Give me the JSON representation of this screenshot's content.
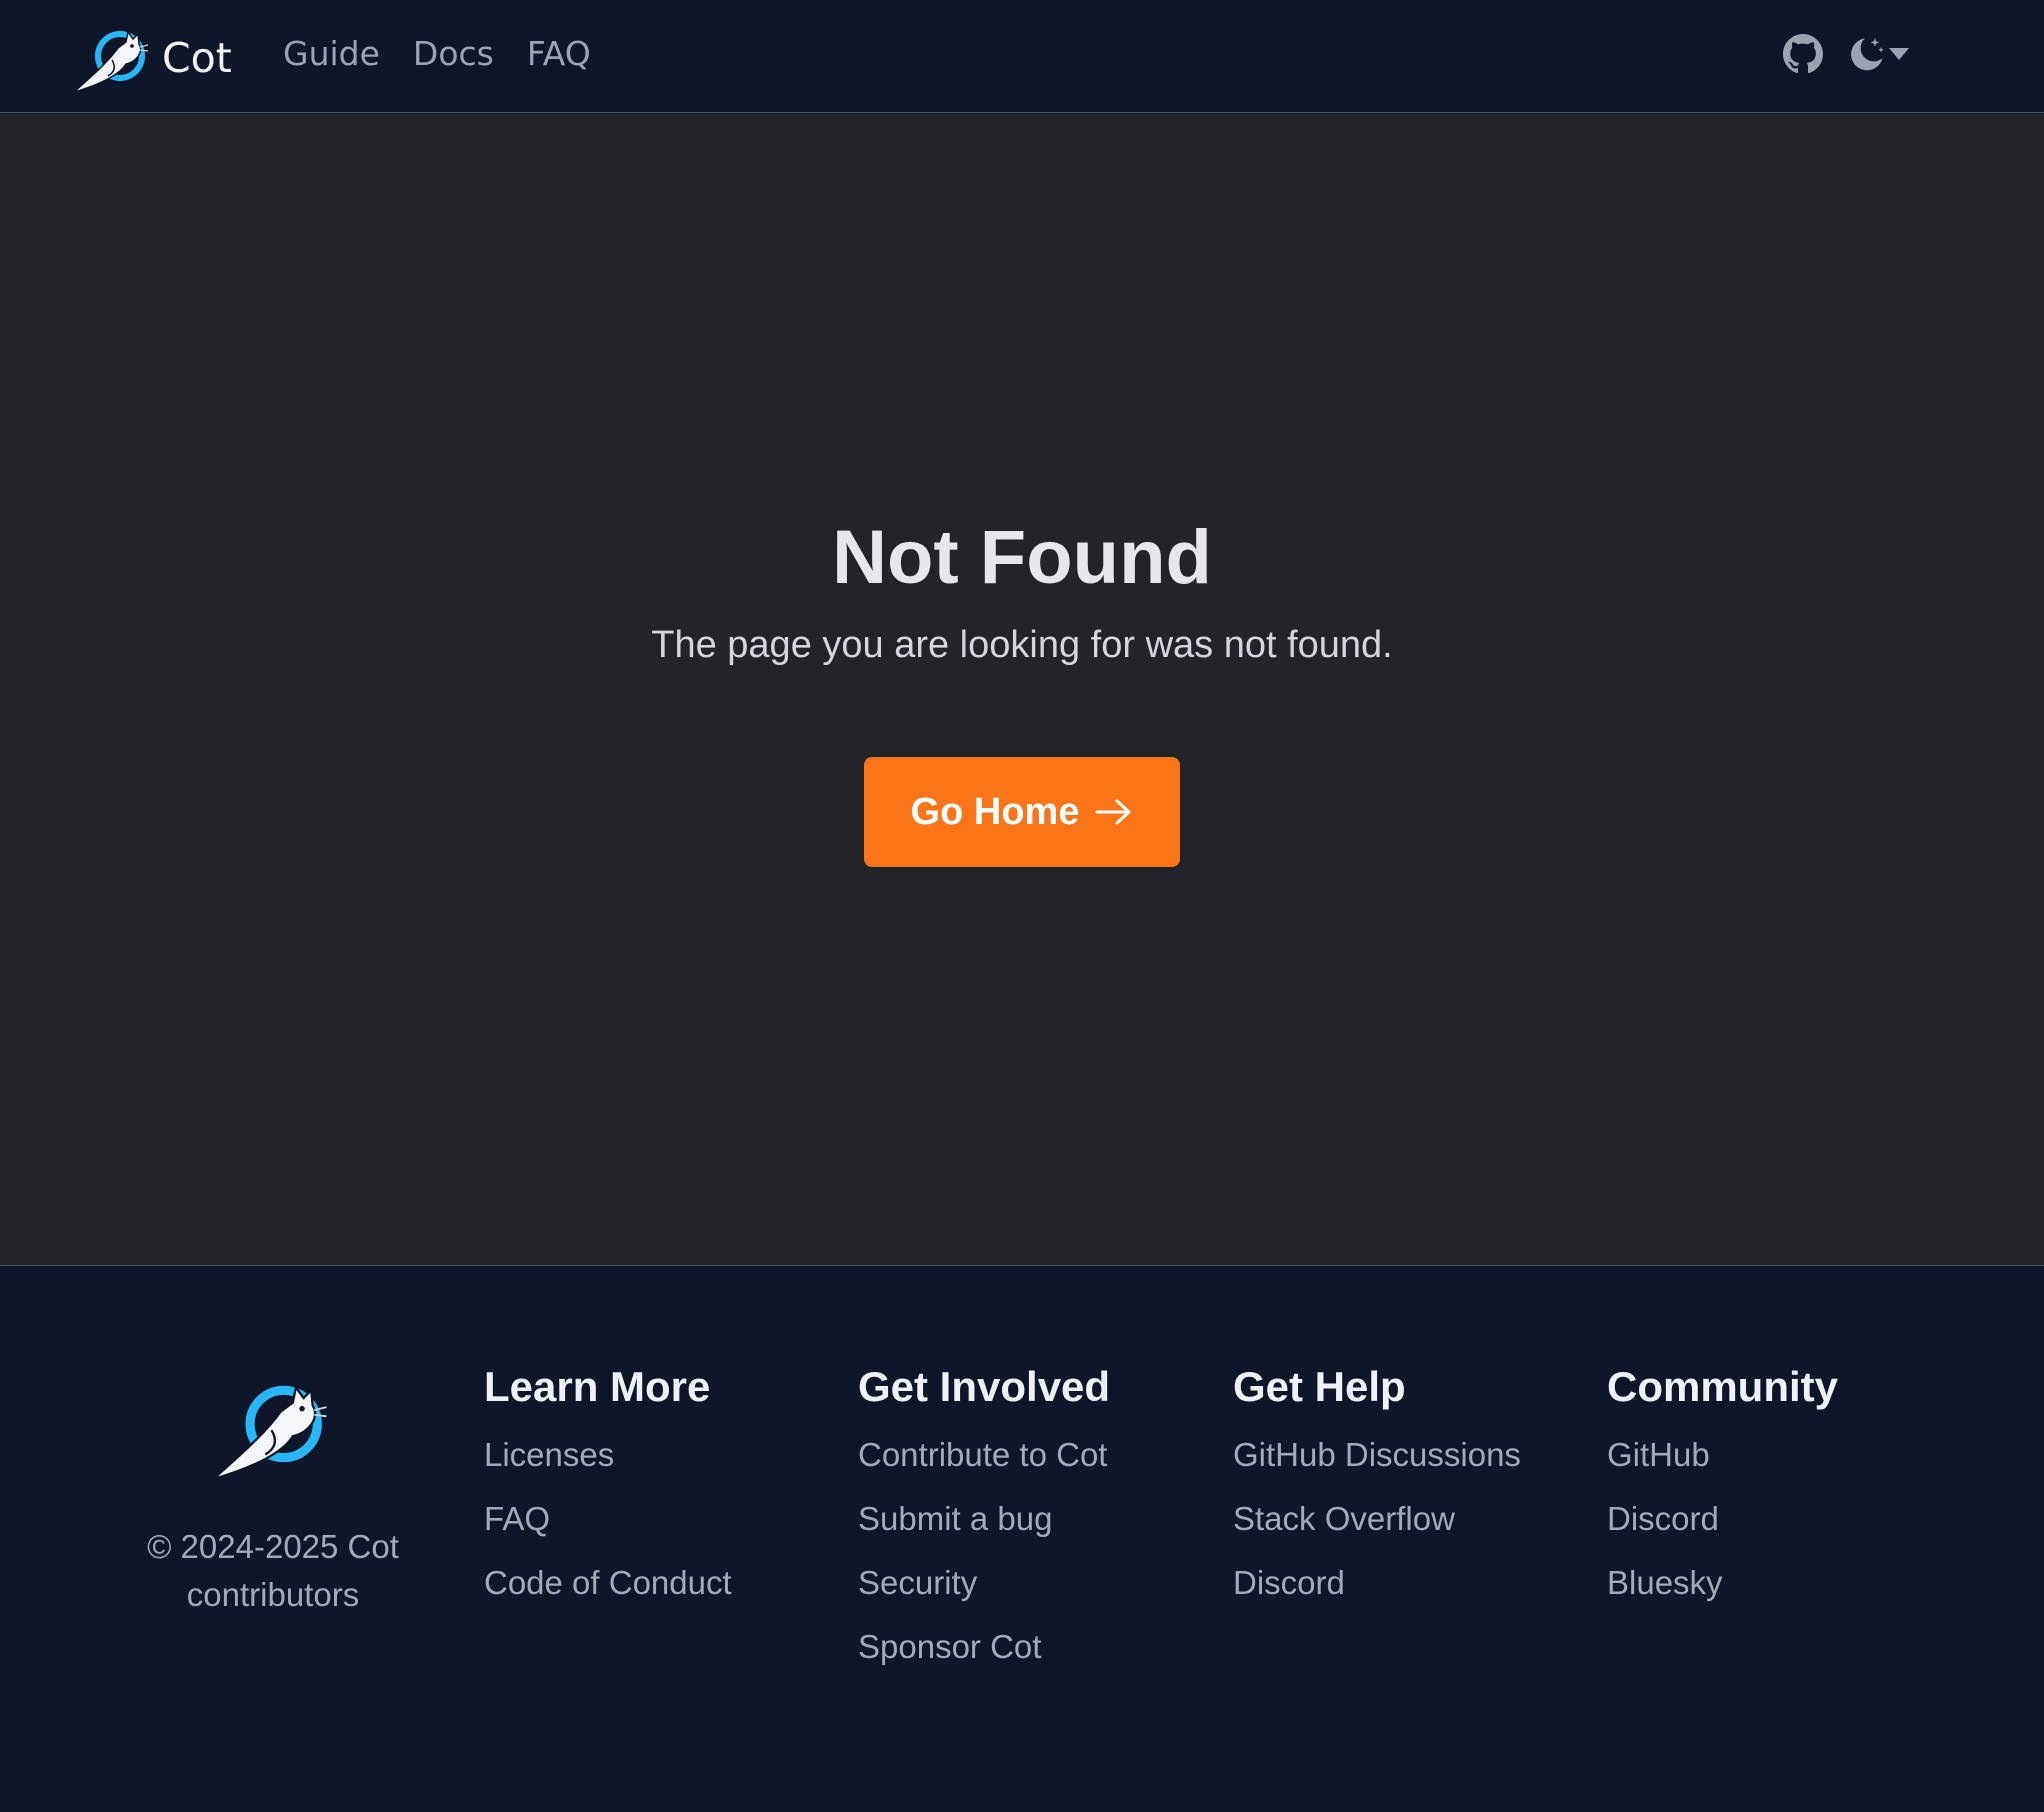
{
  "nav": {
    "brand": "Cot",
    "links": [
      "Guide",
      "Docs",
      "FAQ"
    ],
    "github_icon": "github-icon",
    "theme_icon": "moon-stars-icon",
    "dropdown_icon": "caret-down-icon"
  },
  "main": {
    "title": "Not Found",
    "subtitle": "The page you are looking for was not found.",
    "button_label": "Go Home",
    "button_icon": "arrow-right-icon",
    "button_color": "#f97518"
  },
  "footer": {
    "copyright": "© 2024-2025 Cot contributors",
    "columns": [
      {
        "heading": "Learn More",
        "links": [
          "Licenses",
          "FAQ",
          "Code of Conduct"
        ]
      },
      {
        "heading": "Get Involved",
        "links": [
          "Contribute to Cot",
          "Submit a bug",
          "Security",
          "Sponsor Cot"
        ]
      },
      {
        "heading": "Get Help",
        "links": [
          "GitHub Discussions",
          "Stack Overflow",
          "Discord"
        ]
      },
      {
        "heading": "Community",
        "links": [
          "GitHub",
          "Discord",
          "Bluesky"
        ]
      }
    ]
  },
  "colors": {
    "navbar_bg": "#0e1629",
    "main_bg": "#212429",
    "accent": "#f97518",
    "logo_ring": "#29b6f6"
  }
}
